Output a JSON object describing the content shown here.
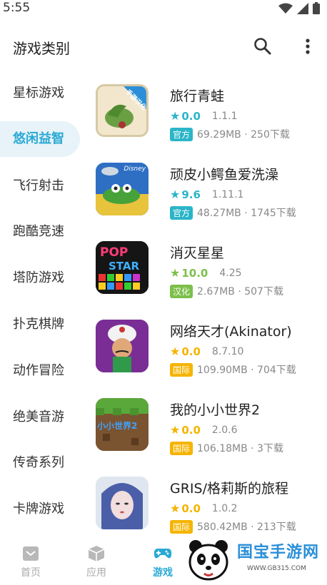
{
  "status": {
    "time": "5:55"
  },
  "header": {
    "title": "游戏类别"
  },
  "sidebar": {
    "items": [
      {
        "label": "星标游戏",
        "active": false
      },
      {
        "label": "悠闲益智",
        "active": true
      },
      {
        "label": "飞行射击",
        "active": false
      },
      {
        "label": "跑酷竞速",
        "active": false
      },
      {
        "label": "塔防游戏",
        "active": false
      },
      {
        "label": "扑克棋牌",
        "active": false
      },
      {
        "label": "动作冒险",
        "active": false
      },
      {
        "label": "绝美音游",
        "active": false
      },
      {
        "label": "传奇系列",
        "active": false
      },
      {
        "label": "卡牌游戏",
        "active": false
      }
    ]
  },
  "games": [
    {
      "name": "旅行青蛙",
      "score": "0.0",
      "version": "1.1.1",
      "tag": "官方",
      "size_downloads": "69.29MB · 250下载",
      "star_color": "#2bb5c8",
      "tag_color": "#2bb5c8"
    },
    {
      "name": "顽皮小鳄鱼爱洗澡",
      "score": "9.6",
      "version": "1.11.1",
      "tag": "官方",
      "size_downloads": "48.27MB · 1745下载",
      "star_color": "#2bb5c8",
      "tag_color": "#2bb5c8"
    },
    {
      "name": "消灭星星",
      "score": "10.0",
      "version": "4.25",
      "tag": "汉化",
      "size_downloads": "2.67MB · 507下载",
      "star_color": "#7cbf4a",
      "tag_color": "#7cbf4a"
    },
    {
      "name": "网络天才(Akinator)",
      "score": "0.0",
      "version": "8.7.10",
      "tag": "国际",
      "size_downloads": "109.90MB · 704下载",
      "star_color": "#f5b400",
      "tag_color": "#f5b400"
    },
    {
      "name": "我的小小世界2",
      "score": "0.0",
      "version": "2.0.6",
      "tag": "国际",
      "size_downloads": "106.18MB · 3下载",
      "star_color": "#f5b400",
      "tag_color": "#f5b400"
    },
    {
      "name": "GRIS/格莉斯的旅程",
      "score": "0.0",
      "version": "1.0.2",
      "tag": "国际",
      "size_downloads": "580.42MB · 213下载",
      "star_color": "#f5b400",
      "tag_color": "#f5b400"
    }
  ],
  "thumb_text": {
    "frog_banner": "手游汉化",
    "disney": "Disney",
    "pop": "POP",
    "star": "STAR",
    "minecraft": "小小世界2"
  },
  "bottom_nav": {
    "items": [
      {
        "label": "首页",
        "icon": "home-icon",
        "active": false
      },
      {
        "label": "应用",
        "icon": "cube-icon",
        "active": false
      },
      {
        "label": "游戏",
        "icon": "gamepad-icon",
        "active": true
      }
    ]
  },
  "watermark": {
    "text": "国宝手游网",
    "url": "WWW.GB315.COM"
  },
  "colors": {
    "accent": "#29a9d4"
  }
}
